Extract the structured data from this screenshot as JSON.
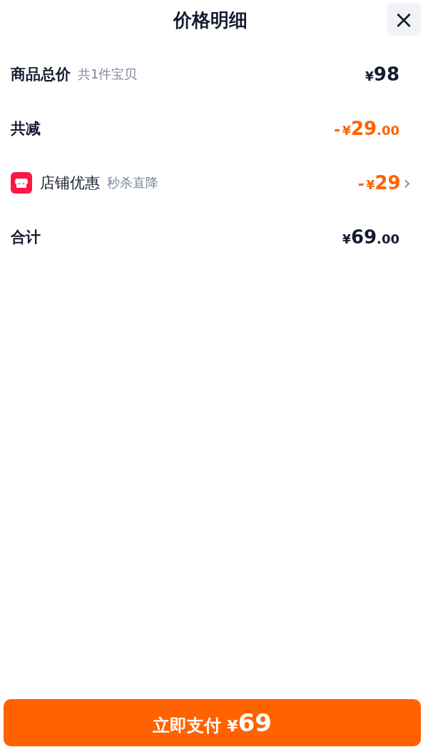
{
  "header": {
    "title": "价格明细",
    "close": "×"
  },
  "rows": [
    {
      "kind": "plain",
      "label": "商品总价",
      "note": "共1件宝贝",
      "amount": {
        "currency": "¥",
        "integer": "98"
      }
    },
    {
      "kind": "discount",
      "label": "共减",
      "amount": {
        "sign": "-",
        "currency": "¥",
        "integer": "29",
        "decimals": ".00"
      }
    },
    {
      "kind": "store-offer",
      "label": "店铺优惠",
      "note": "秒杀直降",
      "amount": {
        "sign": "-",
        "currency": "¥",
        "integer": "29"
      },
      "chevron": "›"
    },
    {
      "kind": "plain",
      "label": "合计",
      "amount": {
        "currency": "¥",
        "integer": "69",
        "decimals": ".00"
      }
    }
  ],
  "pay_button": {
    "label": "立即支付",
    "currency": "¥",
    "integer": "69"
  }
}
